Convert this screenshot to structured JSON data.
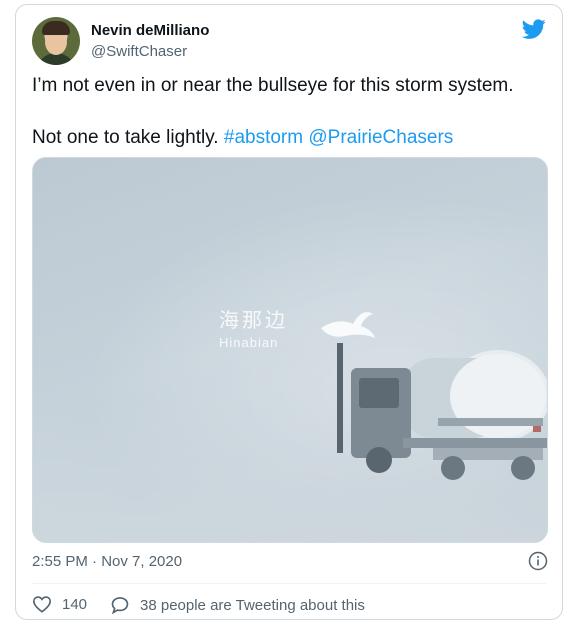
{
  "tweet": {
    "author_name": "Nevin deMilliano",
    "author_handle": "@SwiftChaser",
    "line1": "I’m not even in or near the bullseye for this storm system.",
    "line2_text": "Not one to take lightly. ",
    "hashtag": "#abstorm",
    "mention": "@PrairieChasers",
    "timestamp": "2:55 PM · Nov 7, 2020",
    "likes": "140",
    "conversation": "38 people are Tweeting about this"
  },
  "media": {
    "watermark_cn": "海那边",
    "watermark_en": "Hinabian"
  },
  "colors": {
    "link": "#1d9bf0",
    "twitter_blue": "#1d9bf0",
    "secondary_text": "#536471",
    "border": "#cfd9de"
  },
  "icons": [
    "twitter-bird-icon",
    "info-icon",
    "heart-icon",
    "speech-bubble-icon"
  ]
}
